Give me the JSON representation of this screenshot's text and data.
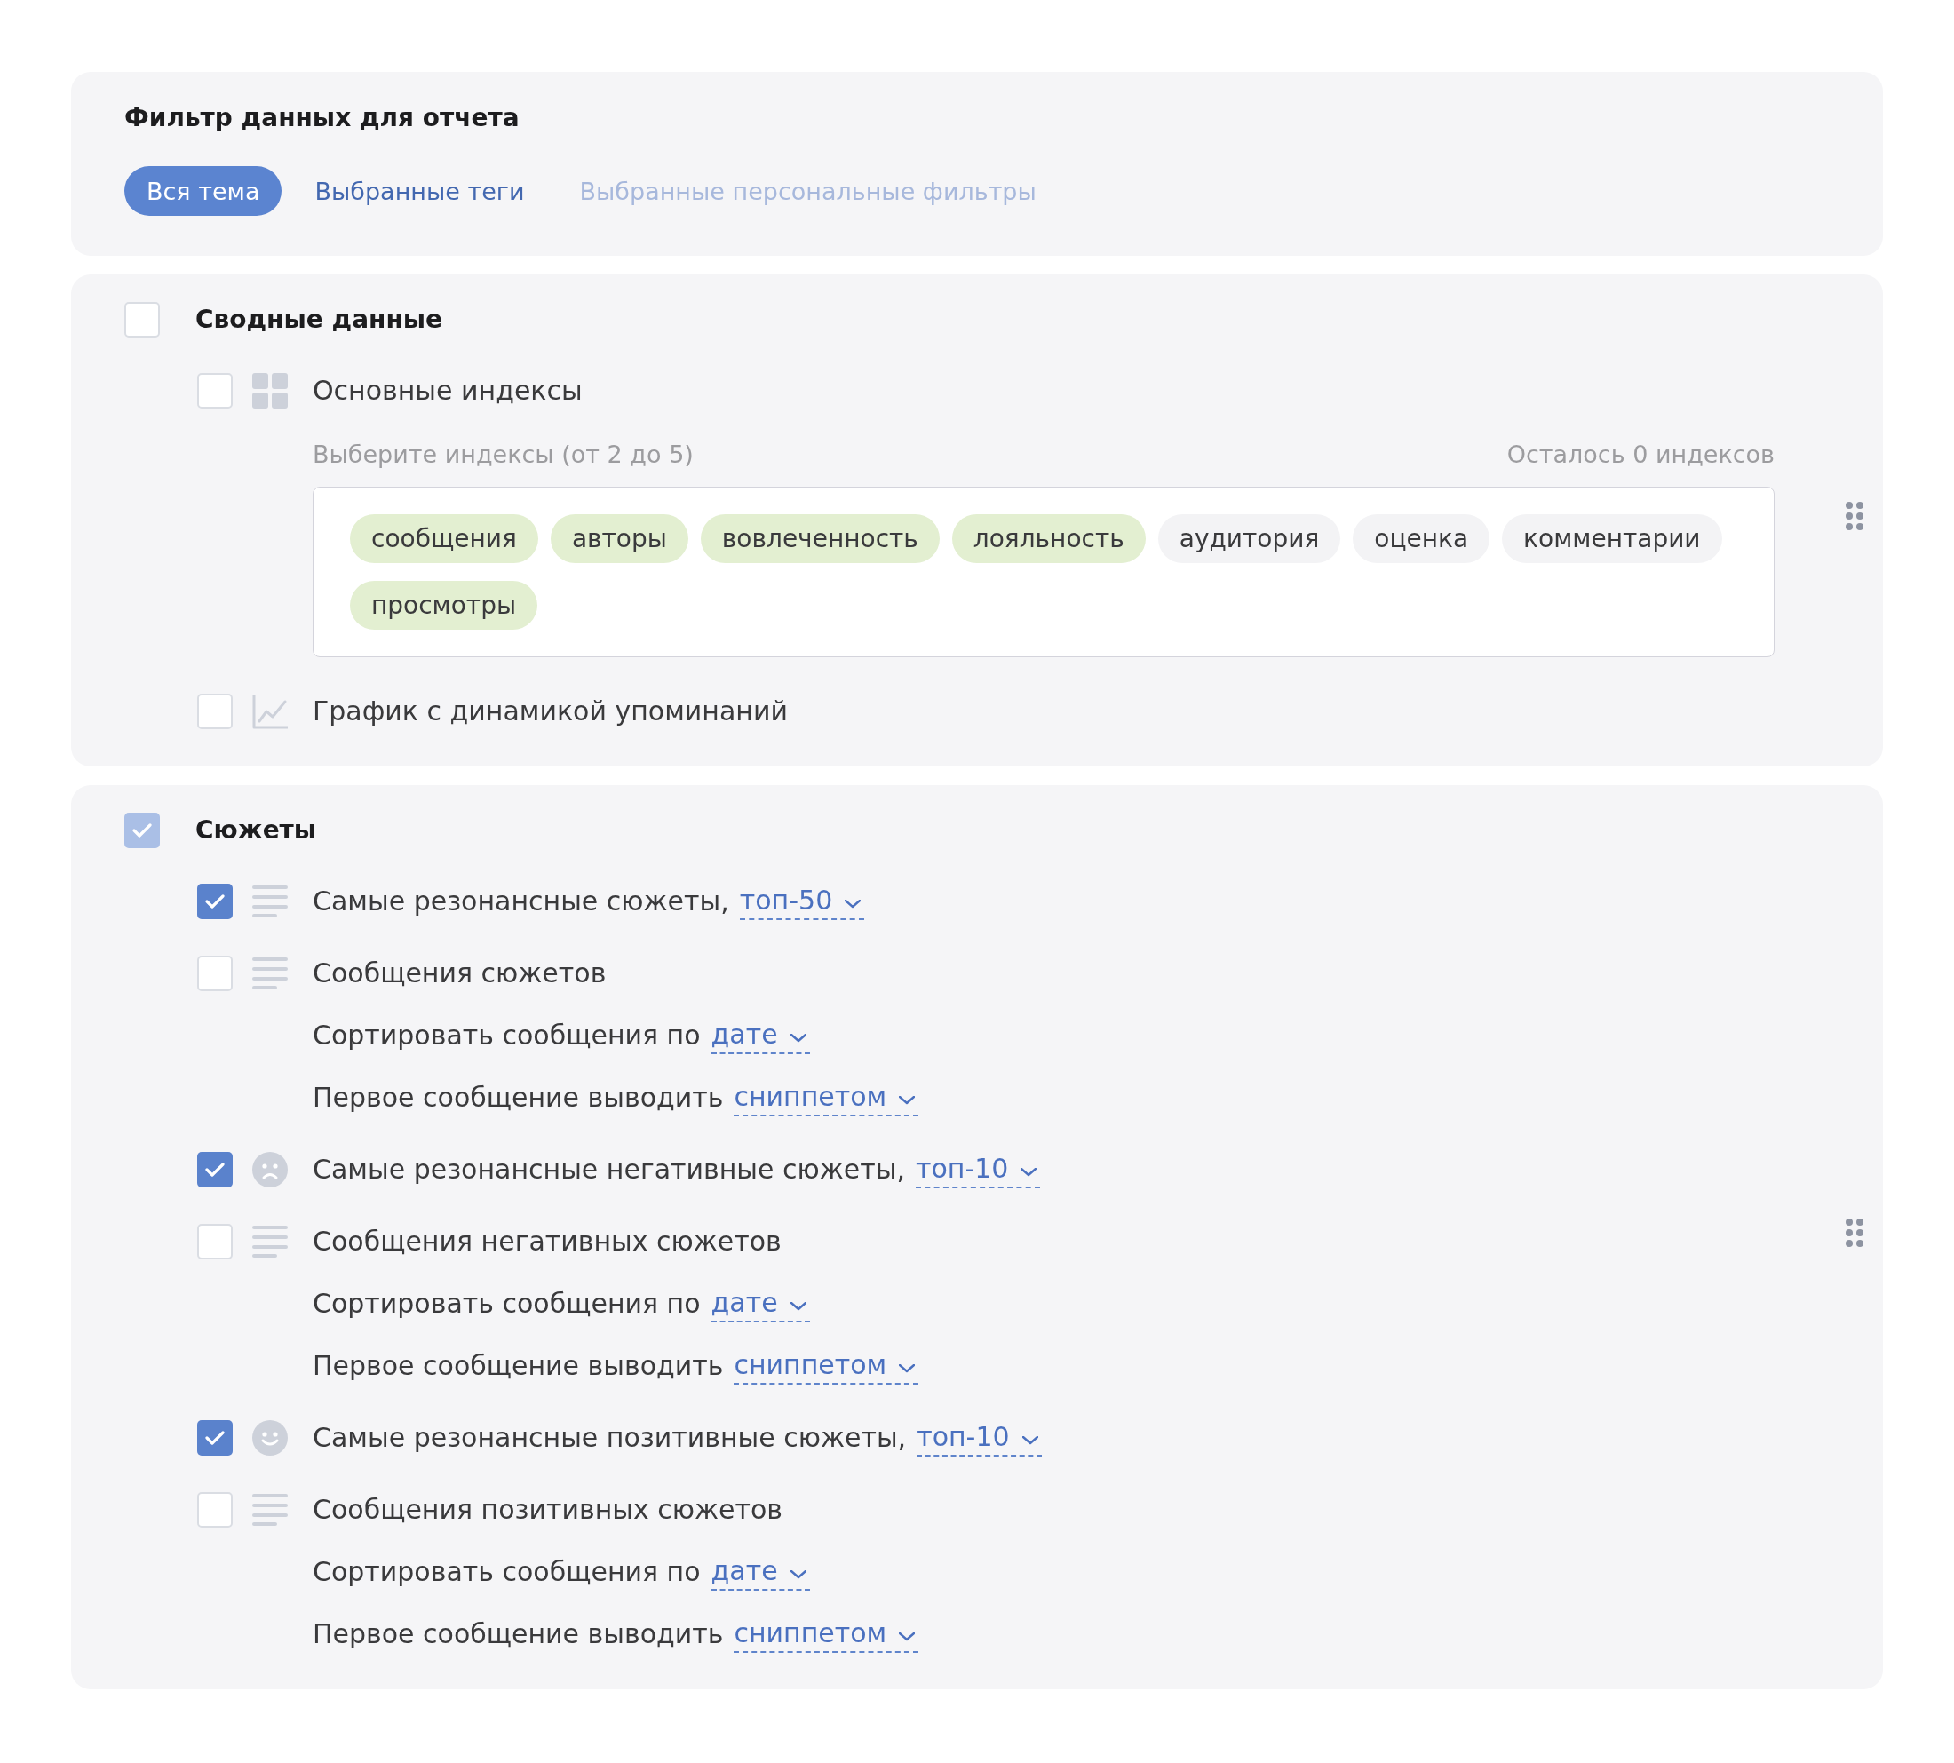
{
  "filter": {
    "title": "Фильтр данных для отчета",
    "tabs": [
      {
        "label": "Вся тема",
        "selected": true,
        "disabled": false
      },
      {
        "label": "Выбранные теги",
        "selected": false,
        "disabled": false
      },
      {
        "label": "Выбранные персональные фильтры",
        "selected": false,
        "disabled": true
      }
    ]
  },
  "sections": [
    {
      "title": "Сводные данные",
      "checked": false,
      "partial": false,
      "items": [
        {
          "kind": "indices",
          "label": "Основные индексы",
          "checked": false,
          "hint": "Выберите индексы (от 2 до 5)",
          "counter": "Осталось 0 индексов",
          "tags": [
            {
              "label": "сообщения",
              "selected": true
            },
            {
              "label": "авторы",
              "selected": true
            },
            {
              "label": "вовлеченность",
              "selected": true
            },
            {
              "label": "лояльность",
              "selected": true
            },
            {
              "label": "аудитория",
              "selected": false
            },
            {
              "label": "оценка",
              "selected": false
            },
            {
              "label": "комментарии",
              "selected": false
            },
            {
              "label": "просмотры",
              "selected": true
            }
          ]
        },
        {
          "kind": "chart",
          "label": "График с динамикой упоминаний",
          "checked": false
        }
      ]
    },
    {
      "title": "Сюжеты",
      "checked": true,
      "partial": true,
      "items": [
        {
          "kind": "list",
          "label": "Самые резонансные сюжеты,",
          "dropdown": "топ-50",
          "checked": true
        },
        {
          "kind": "list",
          "label": "Сообщения сюжетов",
          "checked": false,
          "settings": [
            {
              "label": "Сортировать сообщения по",
              "dropdown": "дате"
            },
            {
              "label": "Первое сообщение выводить",
              "dropdown": "сниппетом"
            }
          ]
        },
        {
          "kind": "negative",
          "label": "Самые резонансные негативные сюжеты,",
          "dropdown": "топ-10",
          "checked": true
        },
        {
          "kind": "list",
          "label": "Сообщения негативных сюжетов",
          "checked": false,
          "settings": [
            {
              "label": "Сортировать сообщения по",
              "dropdown": "дате"
            },
            {
              "label": "Первое сообщение выводить",
              "dropdown": "сниппетом"
            }
          ]
        },
        {
          "kind": "positive",
          "label": "Самые резонансные позитивные сюжеты,",
          "dropdown": "топ-10",
          "checked": true
        },
        {
          "kind": "list",
          "label": "Сообщения позитивных сюжетов",
          "checked": false,
          "settings": [
            {
              "label": "Сортировать сообщения по",
              "dropdown": "дате"
            },
            {
              "label": "Первое сообщение выводить",
              "dropdown": "сниппетом"
            }
          ]
        }
      ]
    }
  ]
}
